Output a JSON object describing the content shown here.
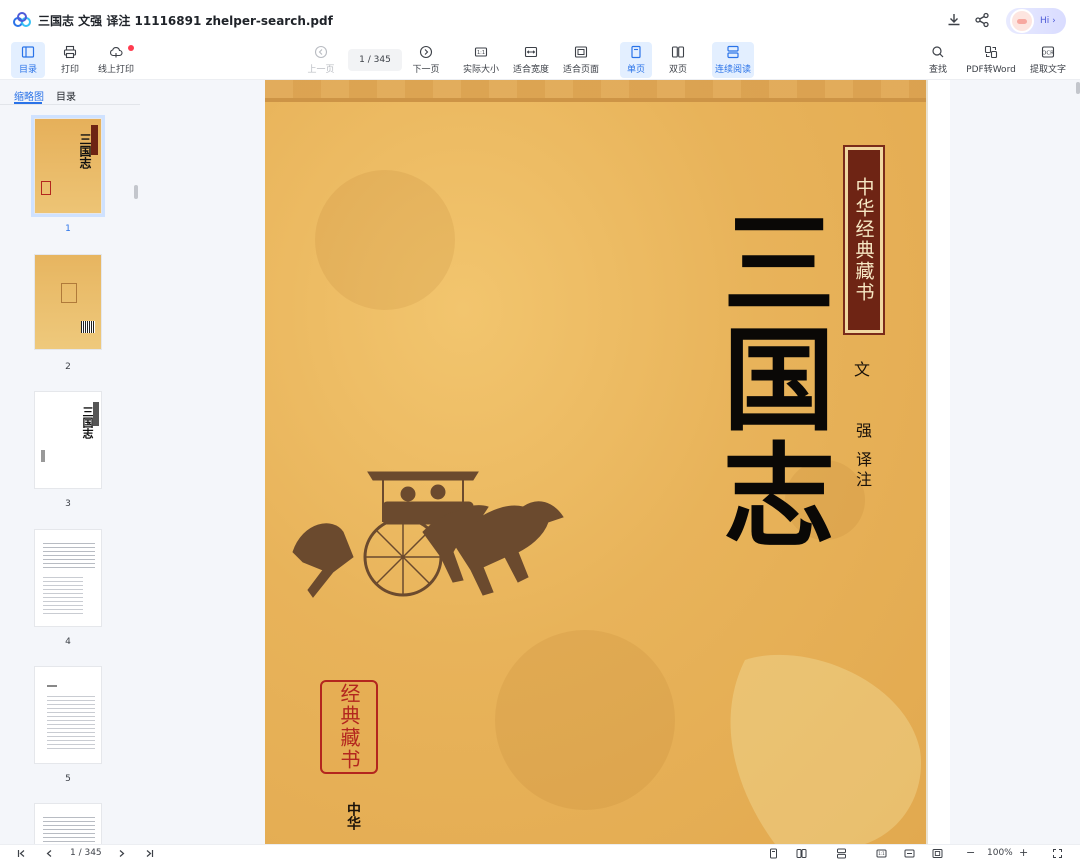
{
  "window": {
    "title": "三国志 文强 译注 11116891 zhelper-search.pdf",
    "assistant_label": "Hi ›",
    "accent": "#2a73e8"
  },
  "toolbar": {
    "left": [
      {
        "label": "目录",
        "icon": "toc-icon",
        "active": true
      },
      {
        "label": "打印",
        "icon": "printer-icon"
      },
      {
        "label": "线上打印",
        "icon": "cloud-print-icon",
        "badge": true
      }
    ],
    "nav": {
      "prev": "上一页",
      "page_indicator": "1 / 345",
      "next": "下一页"
    },
    "view": [
      {
        "label": "实际大小",
        "icon": "actual-size-icon"
      },
      {
        "label": "适合宽度",
        "icon": "fit-width-icon"
      },
      {
        "label": "适合页面",
        "icon": "fit-page-icon"
      },
      {
        "label": "单页",
        "icon": "single-page-icon",
        "active": true
      },
      {
        "label": "双页",
        "icon": "double-page-icon"
      },
      {
        "label": "连续阅读",
        "icon": "continuous-icon",
        "active": true
      }
    ],
    "right": [
      {
        "label": "查找",
        "icon": "search-icon"
      },
      {
        "label": "PDF转Word",
        "icon": "pdf-to-word-icon"
      },
      {
        "label": "提取文字",
        "icon": "extract-text-icon"
      }
    ]
  },
  "sidebar": {
    "tabs": [
      "缩略图",
      "目录"
    ],
    "thumbnails": [
      {
        "num": "1",
        "selected": true
      },
      {
        "num": "2"
      },
      {
        "num": "3"
      },
      {
        "num": "4"
      },
      {
        "num": "5"
      },
      {
        "num": ""
      }
    ],
    "thumb_text": {
      "title": "三国志"
    }
  },
  "cover": {
    "series": "中华经典藏书",
    "title": "三国志",
    "author_a": "文",
    "author_b": "强 译注",
    "seal": "经典藏书",
    "press": "中华"
  },
  "statusbar": {
    "page_indicator": "1 / 345",
    "zoom": "100%",
    "minus": "−",
    "plus": "+"
  }
}
